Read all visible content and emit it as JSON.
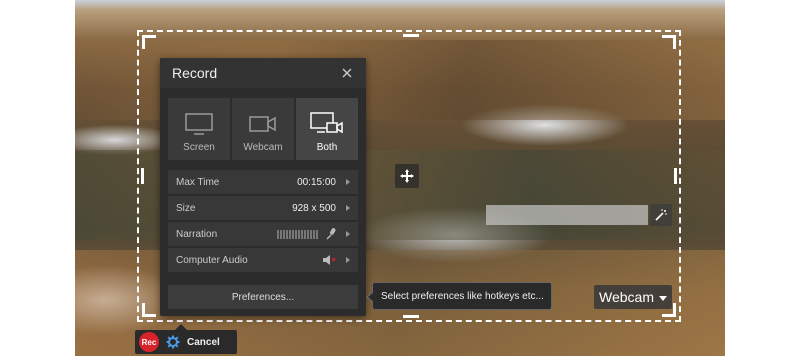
{
  "colors": {
    "accent": "#d9232a",
    "panel_bg": "#2c2c2c",
    "selection_border": "#ffffff"
  },
  "record_panel": {
    "title": "Record",
    "close_icon": "close-icon",
    "modes": [
      {
        "label": "Screen",
        "icon": "monitor-icon",
        "active": false
      },
      {
        "label": "Webcam",
        "icon": "webcam-icon",
        "active": false
      },
      {
        "label": "Both",
        "icon": "monitor-webcam-icon",
        "active": true
      }
    ],
    "rows": {
      "max_time": {
        "label": "Max Time",
        "value": "00:15:00"
      },
      "size": {
        "label": "Size",
        "value": "928 x 500"
      },
      "narration": {
        "label": "Narration",
        "icon": "microphone-icon"
      },
      "computer_audio": {
        "label": "Computer Audio",
        "icon": "speaker-muted-icon"
      }
    },
    "preferences_label": "Preferences..."
  },
  "tooltip": {
    "text": "Select preferences like hotkeys etc..."
  },
  "webcam_dropdown": {
    "label": "Webcam"
  },
  "toolbar": {
    "rec_label": "Rec",
    "settings_icon": "gear-icon",
    "cancel_label": "Cancel"
  }
}
